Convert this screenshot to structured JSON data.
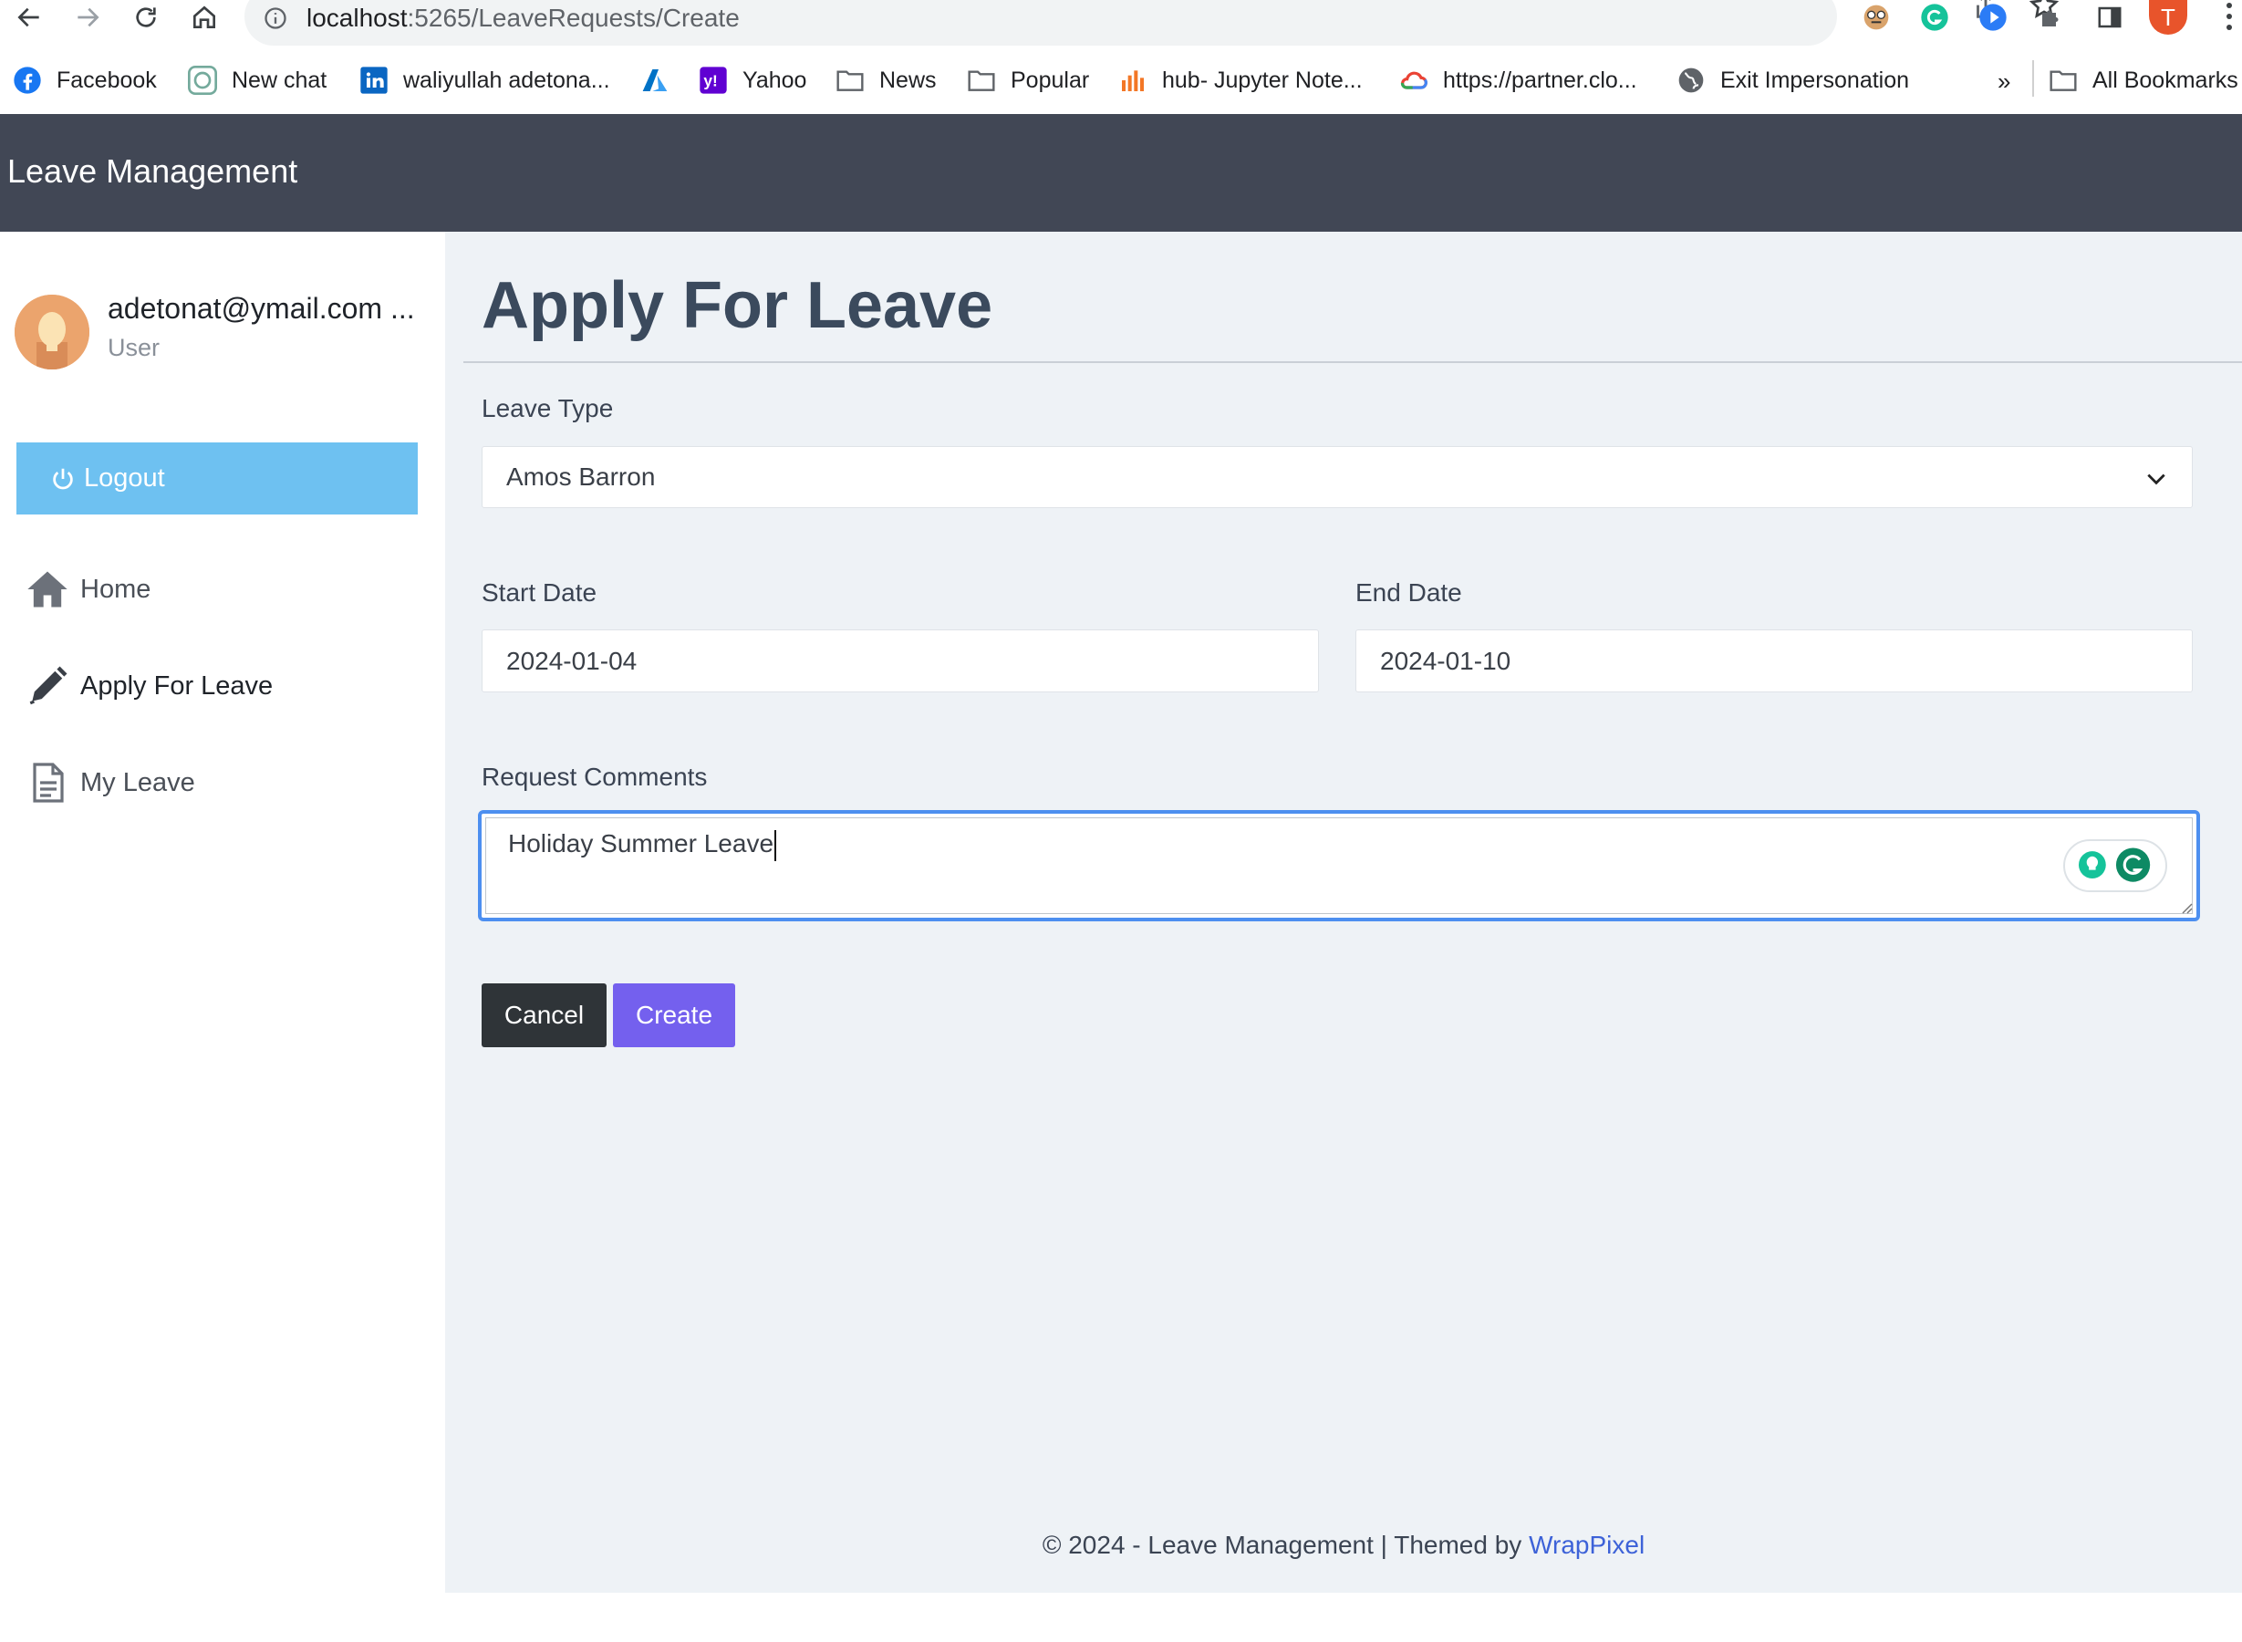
{
  "browser": {
    "url_host": "localhost",
    "url_path": ":5265/LeaveRequests/Create",
    "profile_initial": "T",
    "bookmarks": [
      {
        "label": "Facebook",
        "icon": "facebook-icon"
      },
      {
        "label": "New chat",
        "icon": "chatgpt-icon"
      },
      {
        "label": "waliyullah adetona...",
        "icon": "linkedin-icon"
      },
      {
        "label": "",
        "icon": "azure-icon"
      },
      {
        "label": "Yahoo",
        "icon": "yahoo-icon"
      },
      {
        "label": "News",
        "icon": "folder-icon"
      },
      {
        "label": "Popular",
        "icon": "folder-icon"
      },
      {
        "label": "hub- Jupyter Note...",
        "icon": "jupyter-icon"
      },
      {
        "label": "https://partner.clo...",
        "icon": "google-cloud-icon"
      },
      {
        "label": "Exit Impersonation",
        "icon": "globe-icon"
      }
    ],
    "overflow_label": "»",
    "all_bookmarks_label": "All Bookmarks"
  },
  "app": {
    "brand": "Leave Management"
  },
  "sidebar": {
    "user_email": "adetonat@ymail.com ...",
    "user_role": "User",
    "logout_label": "Logout",
    "items": [
      {
        "label": "Home",
        "icon": "home-icon"
      },
      {
        "label": "Apply For Leave",
        "icon": "pencil-icon"
      },
      {
        "label": "My Leave",
        "icon": "document-icon"
      }
    ]
  },
  "form": {
    "title": "Apply For Leave",
    "leave_type_label": "Leave Type",
    "leave_type_value": "Amos Barron",
    "start_date_label": "Start Date",
    "start_date_value": "2024-01-04",
    "end_date_label": "End Date",
    "end_date_value": "2024-01-10",
    "comments_label": "Request Comments",
    "comments_value": "Holiday Summer Leave",
    "cancel_label": "Cancel",
    "create_label": "Create"
  },
  "footer": {
    "text": "© 2024 - Leave Management | Themed by ",
    "link": "WrapPixel"
  },
  "colors": {
    "topbar": "#414755",
    "main_bg": "#eef2f6",
    "logout": "#6ec1f1",
    "create": "#7460ee",
    "cancel": "#2f3438",
    "focus_ring": "#4d8ff0",
    "link": "#3d62d8"
  }
}
